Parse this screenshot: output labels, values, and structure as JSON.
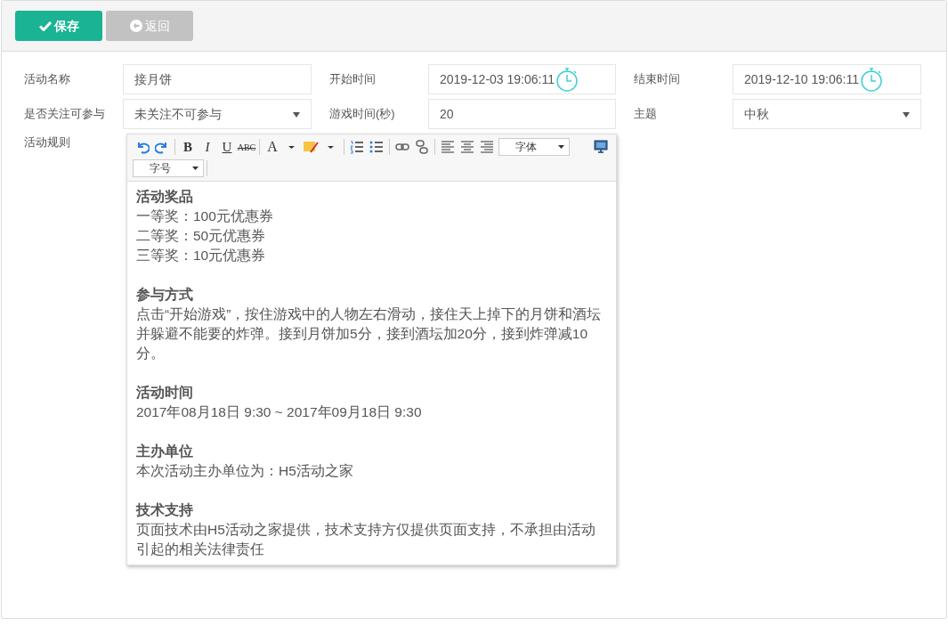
{
  "actions": [
    {
      "label": "保存",
      "kind": "primary"
    },
    {
      "label": "返回",
      "kind": "secondary"
    }
  ],
  "fields": [
    {
      "label": "活动名称",
      "kind": "text",
      "value": "接月饼"
    },
    {
      "label": "开始时间",
      "kind": "datetime",
      "value": "2019-12-03 19:06:11"
    },
    {
      "label": "结束时间",
      "kind": "datetime",
      "value": "2019-12-10 19:06:11"
    },
    {
      "label": "是否关注可参与",
      "kind": "select",
      "value": "未关注不可参与"
    },
    {
      "label": "游戏时间(秒)",
      "kind": "text",
      "value": "20"
    },
    {
      "label": "主题",
      "kind": "select",
      "value": "中秋"
    }
  ],
  "rules": {
    "label": "活动规则",
    "toolbar": {
      "bold": "B",
      "italic": "I",
      "underline": "U",
      "strike": "ABC",
      "font_color": "A",
      "font_menu": "字体",
      "size_menu": "字号"
    },
    "sections": [
      {
        "heading": "活动奖品",
        "lines": [
          "一等奖：100元优惠券",
          "二等奖：50元优惠券",
          "三等奖：10元优惠券"
        ]
      },
      {
        "heading": "参与方式",
        "lines": [
          "点击“开始游戏”，按住游戏中的人物左右滑动，接住天上掉下的月饼和酒坛并躲避不能要的炸弹。接到月饼加5分，接到酒坛加20分，接到炸弹减10分。"
        ]
      },
      {
        "heading": "活动时间",
        "lines": [
          "2017年08月18日 9:30 ~ 2017年09月18日 9:30"
        ]
      },
      {
        "heading": "主办单位",
        "lines": [
          "本次活动主办单位为：H5活动之家"
        ]
      },
      {
        "heading": "技术支持",
        "lines": [
          "页面技术由H5活动之家提供，技术支持方仅提供页面支持，不承担由活动引起的相关法律责任"
        ]
      }
    ]
  }
}
